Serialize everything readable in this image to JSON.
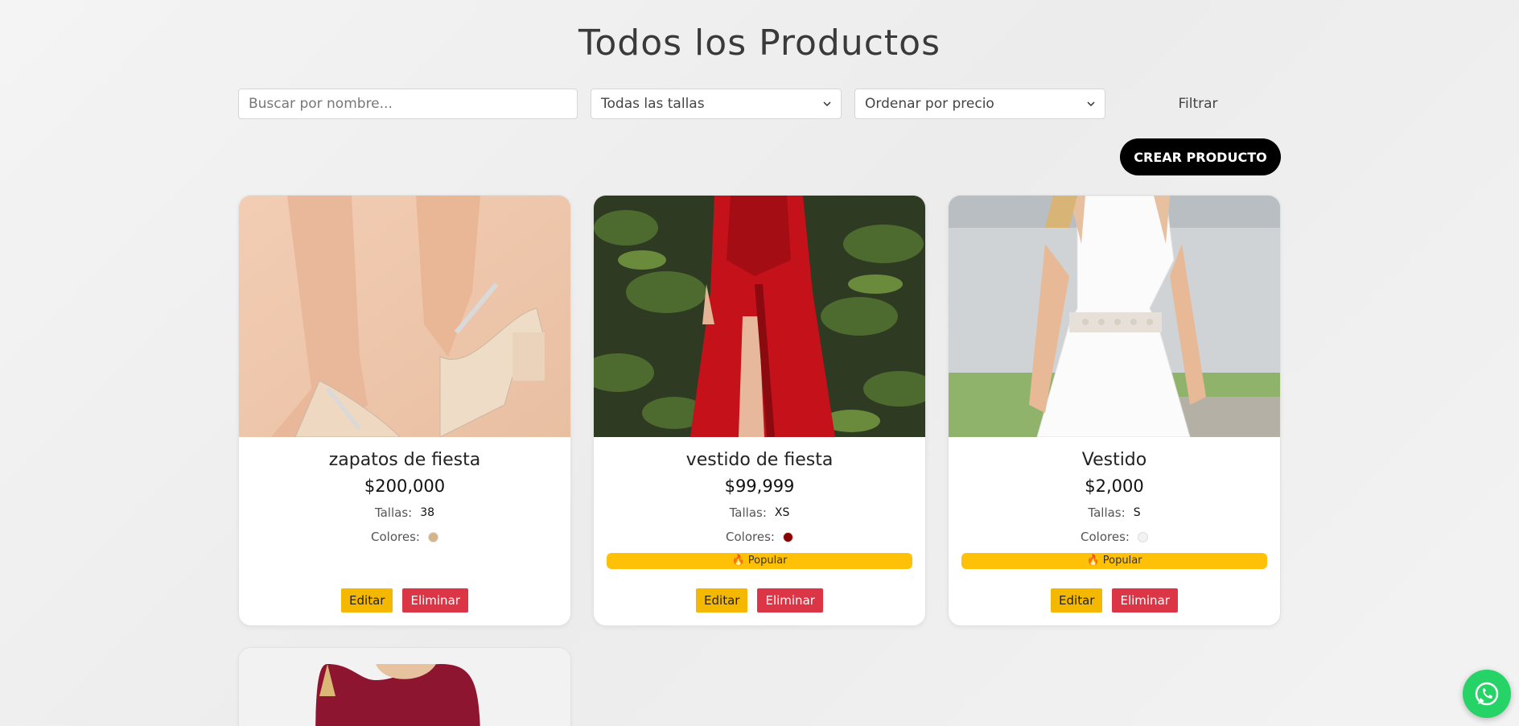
{
  "page": {
    "title": "Todos los Productos"
  },
  "filters": {
    "search_placeholder": "Buscar por nombre...",
    "size_select": "Todas las tallas",
    "sort_select": "Ordenar por precio",
    "filter_button": "Filtrar"
  },
  "actions": {
    "create_button": "CREAR PRODUCTO"
  },
  "labels": {
    "sizes": "Tallas:",
    "colors": "Colores:",
    "edit": "Editar",
    "delete": "Eliminar",
    "popular": "🔥 Popular"
  },
  "products": [
    {
      "name": "zapatos de fiesta",
      "price": "$200,000",
      "sizes": "38",
      "color": "#d6b48a",
      "popular": false,
      "image": "beige heeled sandals"
    },
    {
      "name": "vestido de fiesta",
      "price": "$99,999",
      "sizes": "XS",
      "color": "#8b0000",
      "popular": true,
      "image": "red satin gown"
    },
    {
      "name": "Vestido",
      "price": "$2,000",
      "sizes": "S",
      "color": "#f2f2f2",
      "popular": true,
      "image": "white lace dress"
    }
  ],
  "colors": {
    "edit_bg": "#f5b800",
    "delete_bg": "#dc3545",
    "badge_bg": "#ffc107",
    "create_bg": "#000000",
    "whatsapp_bg": "#25d366"
  },
  "icons": {
    "chevron": "chevron-down-icon",
    "whatsapp": "whatsapp-icon"
  }
}
